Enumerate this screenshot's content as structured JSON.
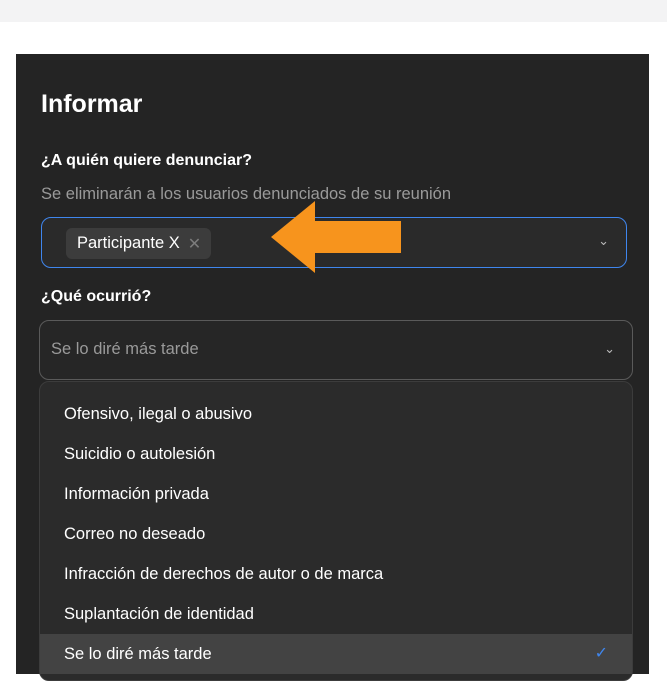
{
  "dialog": {
    "title": "Informar",
    "question_who": "¿A quién quiere denunciar?",
    "subtitle": "Se eliminarán a los usuarios denunciados de su reunión",
    "selected_participant": "Participante X",
    "question_what": "¿Qué ocurrió?",
    "what_value": "Se lo diré más tarde",
    "options": [
      "Ofensivo, ilegal o abusivo",
      "Suicidio o autolesión",
      "Información privada",
      "Correo no deseado",
      "Infracción de derechos de autor o de marca",
      "Suplantación de identidad",
      "Se lo diré más tarde"
    ],
    "selected_option_index": 6
  },
  "colors": {
    "dialog_bg": "#242424",
    "accent": "#3f86ee",
    "annotation_arrow": "#f7941d"
  },
  "icons": {
    "chip_remove": "close-icon",
    "dropdown": "chevron-down-icon",
    "selected_mark": "checkmark-icon",
    "annotation": "left-arrow-icon"
  }
}
